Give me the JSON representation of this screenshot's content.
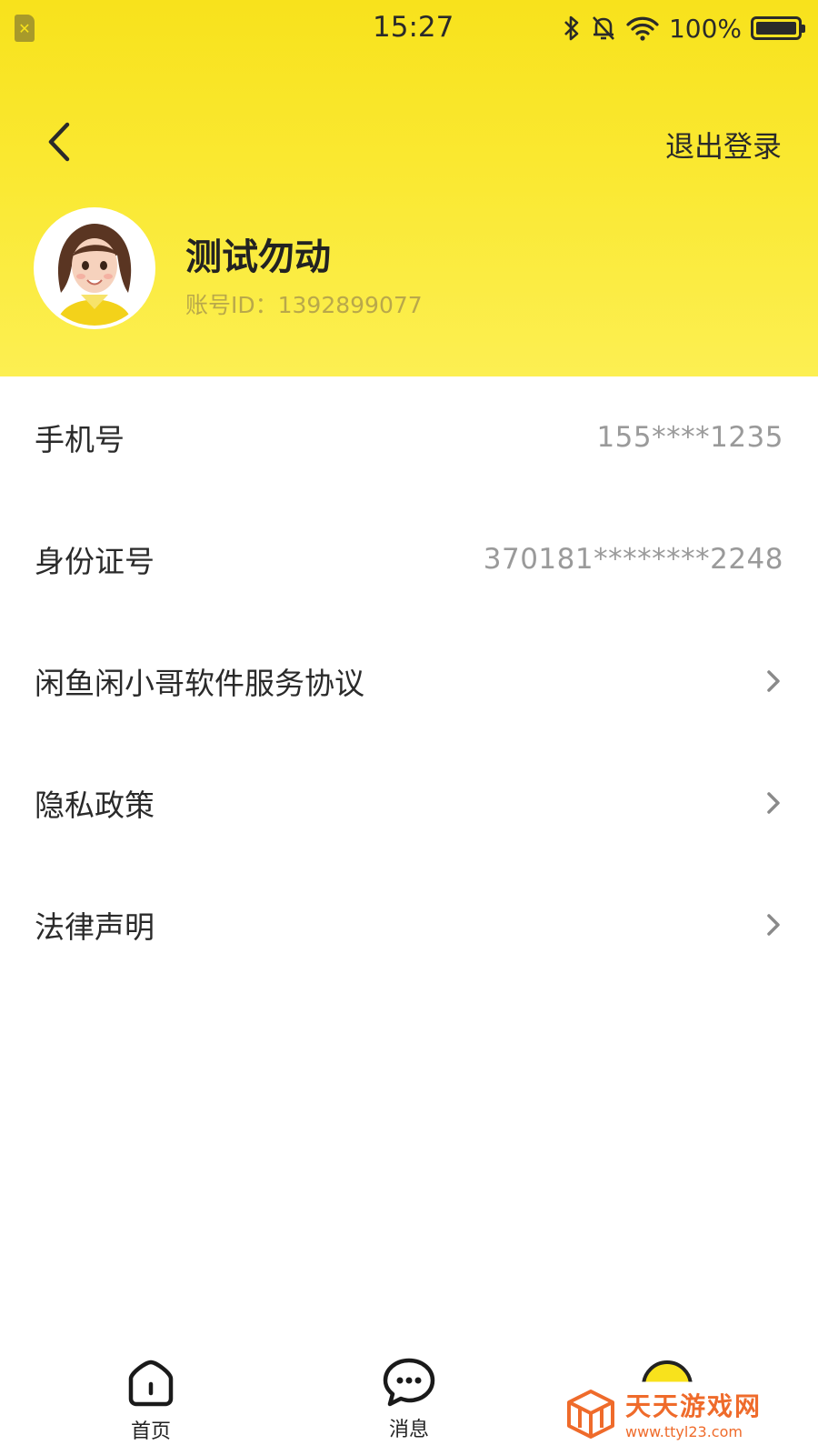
{
  "status_bar": {
    "time": "15:27",
    "battery": "100%",
    "icons": [
      "sim-icon",
      "bluetooth-icon",
      "mute-icon",
      "wifi-icon",
      "battery-icon"
    ]
  },
  "header": {
    "logout_label": "退出登录",
    "user_name": "测试勿动",
    "account_id": "账号ID：1392899077"
  },
  "rows": [
    {
      "label": "手机号",
      "value": "155****1235"
    },
    {
      "label": "身份证号",
      "value": "370181********2248"
    },
    {
      "label": "闲鱼闲小哥软件服务协议"
    },
    {
      "label": "隐私政策"
    },
    {
      "label": "法律声明"
    }
  ],
  "tabs": [
    {
      "label": "首页",
      "icon": "home-icon"
    },
    {
      "label": "消息",
      "icon": "message-icon"
    },
    {
      "label": "",
      "icon": "mine-icon"
    }
  ],
  "watermark": {
    "title": "天天游戏网",
    "url": "www.ttyl23.com"
  },
  "colors": {
    "header_yellow": "#f8e21c",
    "watermark_orange": "#ef6b2b"
  }
}
